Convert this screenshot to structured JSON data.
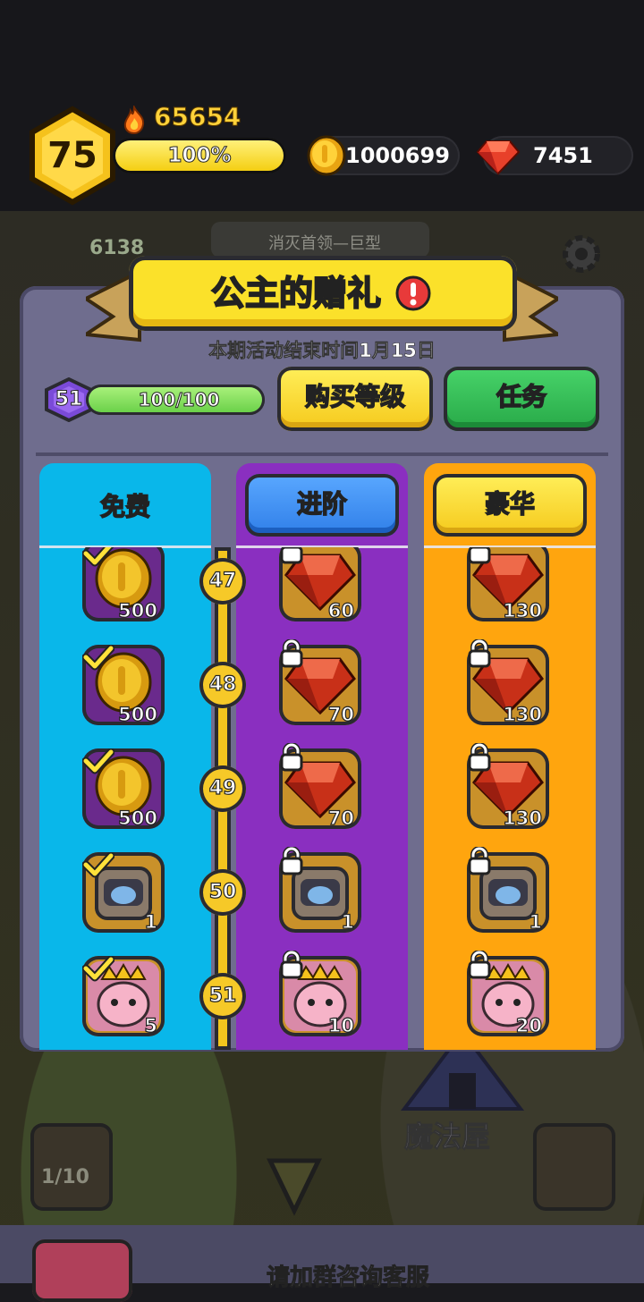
{
  "hud": {
    "player_level": "75",
    "power": "65654",
    "exp_percent_label": "100%",
    "exp_fraction": 1.0,
    "coins": "1000699",
    "gems": "7451",
    "colors": {
      "gold": "#ffd23a",
      "gem": "#e8402a"
    }
  },
  "background": {
    "meat_count": "6138",
    "quest_text": "消灭首领—巨型",
    "house_label": "魔法屋",
    "mushroom_count": "1/10",
    "service_text": "请加群咨询客服"
  },
  "dialog": {
    "title": "公主的赠礼",
    "end_time": "本期活动结束时间1月15日",
    "pass_level": "51",
    "pass_progress": "100/100",
    "pass_fraction": 1.0,
    "buy_level_label": "购买等级",
    "task_label": "任务",
    "tabs": {
      "free": "免费",
      "advanced": "进阶",
      "luxury": "豪华"
    },
    "rows": [
      {
        "level": "47",
        "free": {
          "type": "coin",
          "qty": "500",
          "claimed": true
        },
        "advanced": {
          "type": "gem",
          "qty": "60",
          "locked": true
        },
        "luxury": {
          "type": "gem",
          "qty": "130",
          "locked": true
        }
      },
      {
        "level": "48",
        "free": {
          "type": "coin",
          "qty": "500",
          "claimed": true
        },
        "advanced": {
          "type": "gem",
          "qty": "70",
          "locked": true
        },
        "luxury": {
          "type": "gem",
          "qty": "130",
          "locked": true
        }
      },
      {
        "level": "49",
        "free": {
          "type": "coin",
          "qty": "500",
          "claimed": true
        },
        "advanced": {
          "type": "gem",
          "qty": "70",
          "locked": true
        },
        "luxury": {
          "type": "gem",
          "qty": "130",
          "locked": true
        }
      },
      {
        "level": "50",
        "free": {
          "type": "chest",
          "qty": "1",
          "claimed": true
        },
        "advanced": {
          "type": "chest",
          "qty": "1",
          "locked": true
        },
        "luxury": {
          "type": "chest",
          "qty": "1",
          "locked": true
        }
      },
      {
        "level": "51",
        "free": {
          "type": "princess",
          "qty": "5",
          "claimed": true
        },
        "advanced": {
          "type": "princess",
          "qty": "10",
          "locked": true
        },
        "luxury": {
          "type": "princess",
          "qty": "20",
          "locked": true
        }
      }
    ]
  }
}
